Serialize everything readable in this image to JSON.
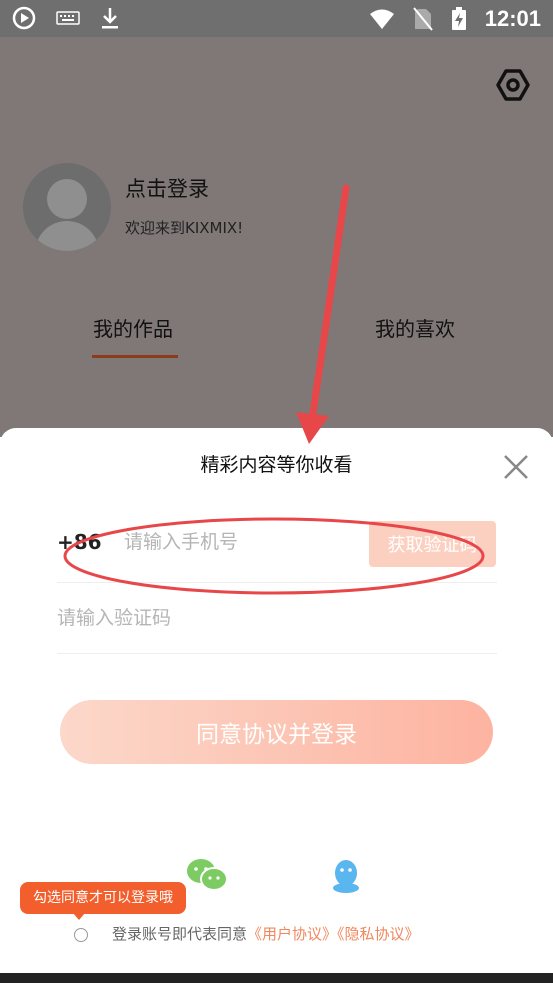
{
  "status_bar": {
    "time": "12:01",
    "icons": [
      "media-play-icon",
      "keyboard-icon",
      "download-icon",
      "wifi-icon",
      "no-sim-icon",
      "battery-charging-icon"
    ]
  },
  "profile": {
    "login_title": "点击登录",
    "welcome": "欢迎来到KIXMIX!",
    "settings_icon": "hexagon-gear-icon"
  },
  "tabs": [
    {
      "label": "我的作品",
      "active": true
    },
    {
      "label": "我的喜欢",
      "active": false
    }
  ],
  "login_sheet": {
    "title": "精彩内容等你收看",
    "country_code": "+86",
    "phone_placeholder": "请输入手机号",
    "get_code_label": "获取验证码",
    "code_placeholder": "请输入验证码",
    "login_button": "同意协议并登录",
    "social": [
      "wechat-icon",
      "qq-icon"
    ],
    "tooltip": "勾选同意才可以登录哦",
    "agreement_prefix": "登录账号即代表同意",
    "user_agreement": "《用户协议》",
    "privacy_policy": "《隐私协议》"
  },
  "colors": {
    "accent": "#f25f2d",
    "button_gradient_start": "#fcd8ca",
    "button_gradient_end": "#fdb3a0",
    "link": "#f0885f",
    "tab_underline": "#8e3b1b",
    "annotation": "#e8474a"
  }
}
